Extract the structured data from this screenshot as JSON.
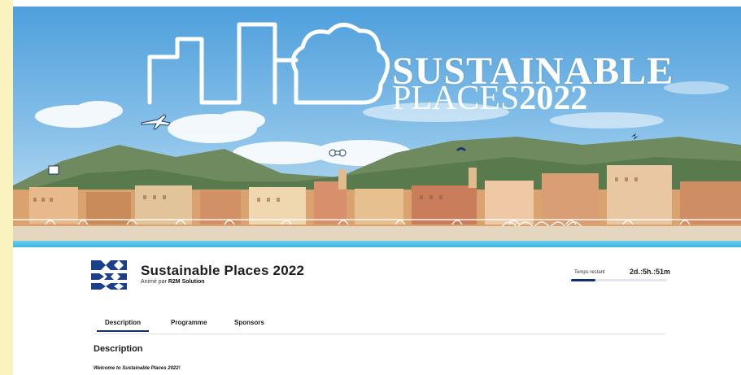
{
  "banner": {
    "title": "SUSTAINABLE",
    "subtitle_light": "PLACES",
    "subtitle_bold": "2022"
  },
  "event": {
    "title": "Sustainable Places 2022",
    "host_prefix": "Animé par",
    "host_name": "R2M Solution",
    "logo_icon": "grid-puzzle-logo-icon"
  },
  "timer": {
    "label": "Temps restant",
    "value": "2d.:5h.:51m",
    "progress": 0.25
  },
  "tabs": [
    {
      "label": "Description",
      "active": true
    },
    {
      "label": "Programme",
      "active": false
    },
    {
      "label": "Sponsors",
      "active": false
    }
  ],
  "content": {
    "heading": "Description",
    "welcome": "Welcome to Sustainable Places 2022!"
  },
  "colors": {
    "page_background": "#fbf3bf",
    "accent": "#0f2f6e",
    "sky_top": "#5ea8e0",
    "sea": "#54c4e8"
  }
}
